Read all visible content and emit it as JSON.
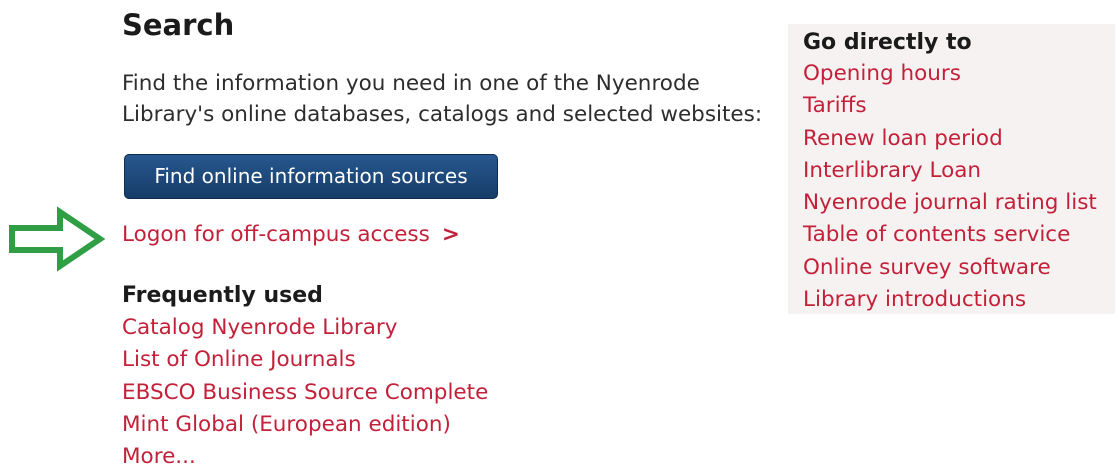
{
  "search": {
    "title": "Search",
    "intro_line1": "Find the information you need in one of the Nyenrode",
    "intro_line2": "Library's online databases, catalogs and selected websites:",
    "find_button_label": "Find online information sources",
    "logon_link": "Logon for off-campus access",
    "logon_chevron": ">"
  },
  "frequently_used": {
    "heading": "Frequently used",
    "items": [
      {
        "label": "Catalog Nyenrode Library"
      },
      {
        "label": "List of Online Journals"
      },
      {
        "label": "EBSCO Business Source Complete"
      },
      {
        "label": "Mint Global (European edition)"
      },
      {
        "label": "More..."
      }
    ]
  },
  "go_directly": {
    "heading": "Go directly to",
    "items": [
      {
        "label": "Opening hours"
      },
      {
        "label": "Tariffs"
      },
      {
        "label": "Renew loan period"
      },
      {
        "label": "Interlibrary Loan"
      },
      {
        "label": "Nyenrode journal rating list"
      },
      {
        "label": "Table of contents service"
      },
      {
        "label": "Online survey software"
      },
      {
        "label": "Library introductions"
      }
    ]
  },
  "colors": {
    "link": "#c3213a",
    "button": "#1e4a7c",
    "arrow": "#2f9e45",
    "sidebar_bg": "#f7f2f2"
  },
  "icons": {
    "annotation_arrow": "arrow-right-outline-icon"
  }
}
